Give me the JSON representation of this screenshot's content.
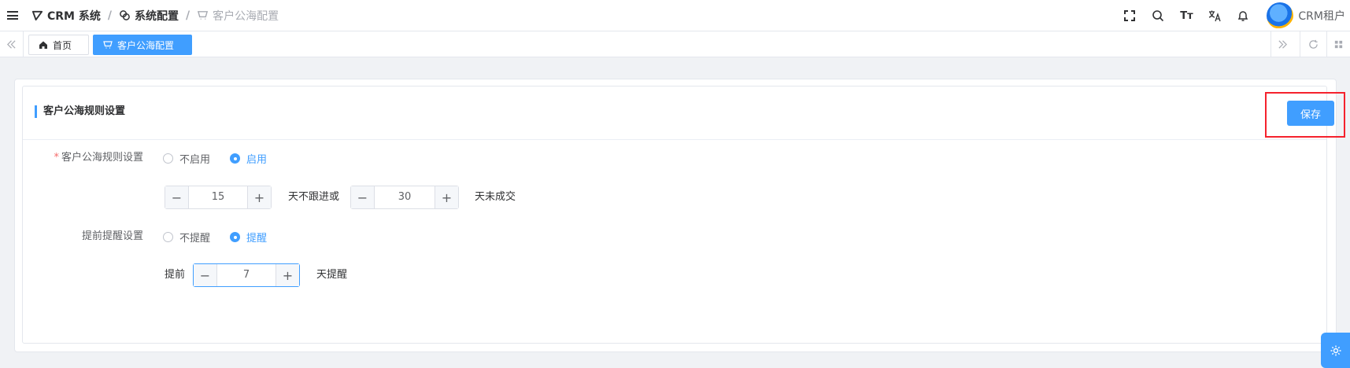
{
  "header": {
    "breadcrumbs": [
      {
        "label": "CRM 系统",
        "icon": "logo-icon"
      },
      {
        "label": "系统配置",
        "icon": "config-icon"
      },
      {
        "label": "客户公海配置",
        "icon": "cart-icon"
      }
    ],
    "icons": [
      "fullscreen-icon",
      "search-icon",
      "font-size-icon",
      "translate-icon",
      "bell-icon"
    ],
    "font_size_glyph": "Tт",
    "username": "CRM租户"
  },
  "tags": {
    "home": "首页",
    "active": "客户公海配置"
  },
  "panel": {
    "title": "客户公海规则设置",
    "save_label": "保存"
  },
  "form": {
    "rule": {
      "label": "客户公海规则设置",
      "required_mark": "*",
      "options": [
        "不启用",
        "启用"
      ],
      "selected": "启用"
    },
    "followup": {
      "no_followup_days": "15",
      "no_followup_text": "天不跟进或",
      "no_deal_days": "30",
      "no_deal_text": "天未成交"
    },
    "reminder": {
      "label": "提前提醒设置",
      "options": [
        "不提醒",
        "提醒"
      ],
      "selected": "提醒",
      "prefix": "提前",
      "days": "7",
      "suffix": "天提醒"
    }
  },
  "colors": {
    "primary": "#409eff",
    "highlight_border": "#f5222d"
  }
}
